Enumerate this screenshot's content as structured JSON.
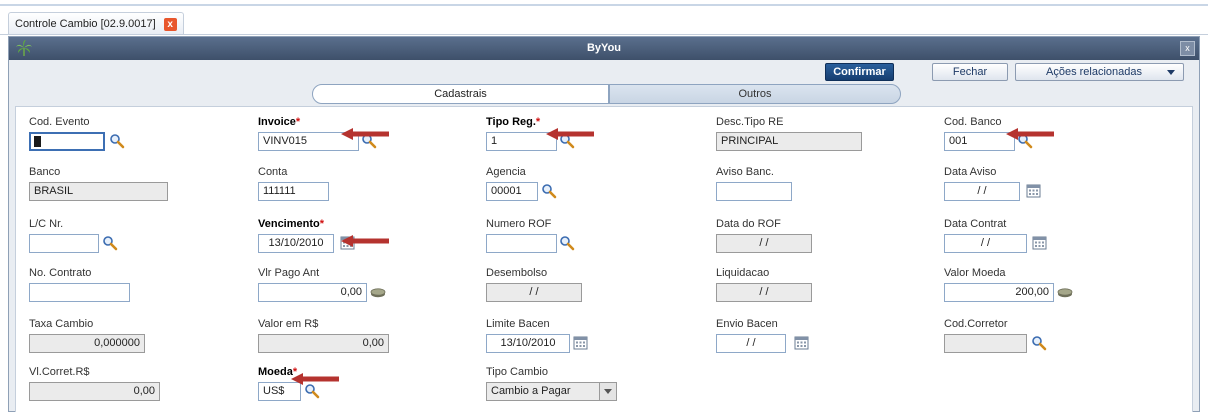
{
  "doc_tab": {
    "label": "Controle Cambio [02.9.0017]",
    "close": "x"
  },
  "window": {
    "title": "ByYou",
    "close": "x"
  },
  "toolbar": {
    "confirm": "Confirmar",
    "close": "Fechar",
    "actions": "Ações relacionadas"
  },
  "tabs": {
    "cadastrais": "Cadastrais",
    "outros": "Outros"
  },
  "required_mark": "*",
  "fields": {
    "cod_evento": {
      "label": "Cod. Evento",
      "value": ""
    },
    "invoice": {
      "label": "Invoice",
      "value": "VINV015"
    },
    "tipo_reg": {
      "label": "Tipo Reg.",
      "value": "1"
    },
    "desc_tipo_re": {
      "label": "Desc.Tipo RE",
      "value": "PRINCIPAL"
    },
    "cod_banco": {
      "label": "Cod. Banco",
      "value": "001"
    },
    "banco": {
      "label": "Banco",
      "value": "BRASIL"
    },
    "conta": {
      "label": "Conta",
      "value": "111111"
    },
    "agencia": {
      "label": "Agencia",
      "value": "00001"
    },
    "aviso_banc": {
      "label": "Aviso Banc.",
      "value": ""
    },
    "data_aviso": {
      "label": "Data Aviso",
      "value": "/ /"
    },
    "lc_nr": {
      "label": "L/C Nr.",
      "value": ""
    },
    "vencimento": {
      "label": "Vencimento",
      "value": "13/10/2010"
    },
    "numero_rof": {
      "label": "Numero ROF",
      "value": ""
    },
    "data_rof": {
      "label": "Data do ROF",
      "value": "/ /"
    },
    "data_contrat": {
      "label": "Data Contrat",
      "value": "/ /"
    },
    "no_contrato": {
      "label": "No. Contrato",
      "value": ""
    },
    "vlr_pago_ant": {
      "label": "Vlr Pago Ant",
      "value": "0,00"
    },
    "desembolso": {
      "label": "Desembolso",
      "value": "/ /"
    },
    "liquidacao": {
      "label": "Liquidacao",
      "value": "/ /"
    },
    "valor_moeda": {
      "label": "Valor Moeda",
      "value": "200,00"
    },
    "taxa_cambio": {
      "label": "Taxa Cambio",
      "value": "0,000000"
    },
    "valor_rs": {
      "label": "Valor em R$",
      "value": "0,00"
    },
    "limite_bacen": {
      "label": "Limite Bacen",
      "value": "13/10/2010"
    },
    "envio_bacen": {
      "label": "Envio Bacen",
      "value": "/ /"
    },
    "cod_corretor": {
      "label": "Cod.Corretor",
      "value": ""
    },
    "vl_corret": {
      "label": "Vl.Corret.R$",
      "value": "0,00"
    },
    "moeda": {
      "label": "Moeda",
      "value": "US$"
    },
    "tipo_cambio": {
      "label": "Tipo Cambio",
      "value": "Cambio a Pagar"
    }
  },
  "colors": {
    "accent": "#1e4a82",
    "arrow": "#b5332f",
    "required": "#d01010"
  },
  "icons": [
    "palm-logo-icon",
    "search-icon",
    "calendar-icon",
    "money-icon",
    "chevron-down-icon"
  ]
}
